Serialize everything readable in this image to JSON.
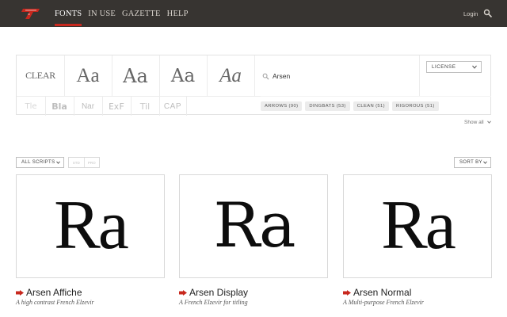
{
  "colors": {
    "topbar": "#373431",
    "accent": "#c8281e",
    "text": "#333333"
  },
  "topbar": {
    "logo_icon": "site-logo",
    "nav": [
      "FONTS",
      "IN USE",
      "GAZETTE",
      "HELP"
    ],
    "active_nav": "FONTS",
    "login": "Login",
    "search_icon": "search-icon"
  },
  "filters": {
    "clear": "CLEAR",
    "styles": [
      "Aa",
      "Aa",
      "Aa",
      "Aa"
    ],
    "sub_styles": [
      "Tle",
      "Bla",
      "Nar",
      "ExF",
      "Til",
      "CAP"
    ],
    "search": {
      "value": "Arsen",
      "placeholder": ""
    },
    "license": "LICENSE",
    "tags": [
      "ARROWS (90)",
      "DINGBATS (53)",
      "CLEAN (51)",
      "RIGOROUS (51)"
    ],
    "show_all": "Show all"
  },
  "toolbar": {
    "scripts": "ALL SCRIPTS",
    "segments": [
      "STD",
      "PRO"
    ],
    "sort": "SORT BY"
  },
  "results": [
    {
      "sample": "Ra",
      "name": "Arsen Affiche",
      "description": "A high contrast French Elzevir"
    },
    {
      "sample": "Ra",
      "name": "Arsen Display",
      "description": "A French Elzevir for titling"
    },
    {
      "sample": "Ra",
      "name": "Arsen Normal",
      "description": "A Multi-purpose French Elzevir"
    }
  ]
}
